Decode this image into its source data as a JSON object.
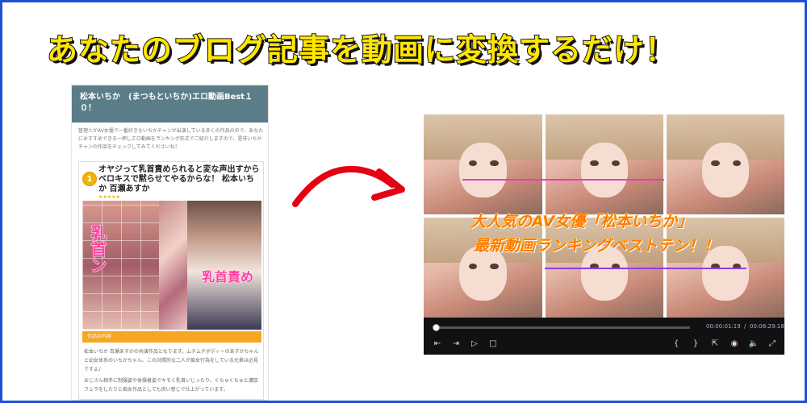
{
  "headline": "あなたのブログ記事を動画に変換するだけ！",
  "blog": {
    "title": "松本いちか　(まつもといちか)エロ動画Best１０！",
    "intro": "管理人がAV女優で一番好きないちかチャンが出演している多くの作品の中で、あなたにおすすめできる一押しエロ動画をランキング形式でご紹介しますので、是非いちかチャンの作品をチェックしてみてくださいね！",
    "card": {
      "rank": "1",
      "title": "オヤジって乳首責められると変な声出すからベロキスで黙らせてやるからな！ 松本いちか 百瀬あすか",
      "stars": "★★★★★",
      "cover_text_left": "乳首ン",
      "cover_text_right": "乳首責め",
      "caption": "作品の内容",
      "desc1": "松本いちか 百瀬あすかの共演作品となります。ムチムチボディーのあすかちゃんと幼女体系のいちかちゃん、この対照的な二人が痴女行為をしている光景は必見ですよ♪",
      "desc2": "おじさん相手に制服姿や体操着姿でキモく乳首いじったり、くちゅくちゅと濃厚フェラをしたりと痴女作品としても良い感じで仕上がっています。"
    }
  },
  "player": {
    "overlay_line1": "大人気のAV女優「松本いちか」",
    "overlay_line2": "最新動画ランキングベストテン！！",
    "progress": 0.01,
    "time_current": "00:00:01:19",
    "time_separator": "/",
    "time_total": "00:08:29:18",
    "controls": {
      "prev": "⇤",
      "step": "⇥",
      "play": "▷",
      "stop": "□",
      "mark_in": "{",
      "mark_out": "}",
      "export": "⇱",
      "snapshot": "◉",
      "volume": "🔈",
      "fullscreen": "⤢"
    }
  }
}
